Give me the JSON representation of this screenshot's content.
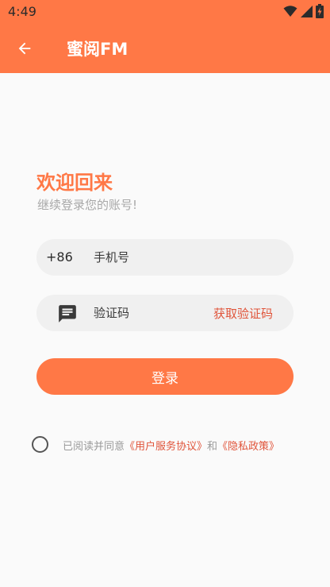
{
  "status_bar": {
    "time": "4:49"
  },
  "app_bar": {
    "title": "蜜阅FM"
  },
  "login": {
    "welcome": "欢迎回来",
    "subtitle": "继续登录您的账号!",
    "phone_prefix": "+86",
    "phone_placeholder": "手机号",
    "code_placeholder": "验证码",
    "get_code_label": "获取验证码",
    "submit_label": "登录"
  },
  "agreement": {
    "prefix": "已阅读并同意",
    "user_agreement": "《用户服务协议》",
    "and": "和",
    "privacy_policy": "《隐私政策》"
  },
  "colors": {
    "accent": "#ff7846",
    "link": "#e0543a"
  }
}
